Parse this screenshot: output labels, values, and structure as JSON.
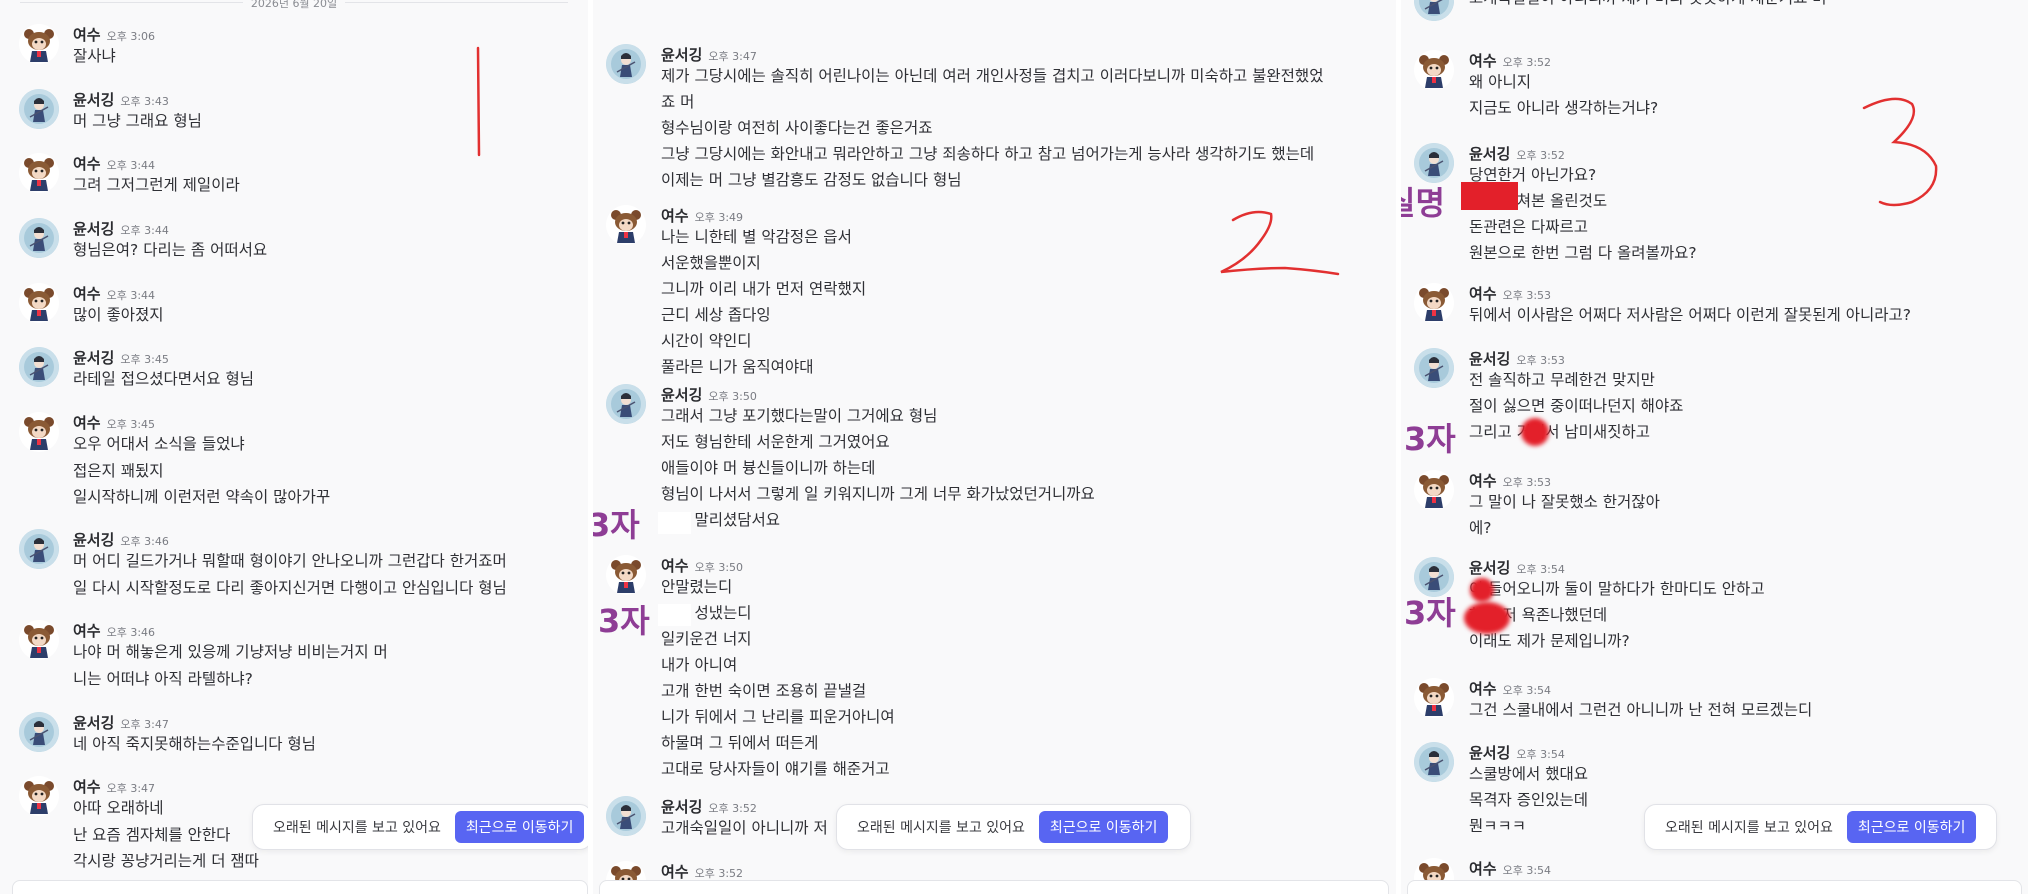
{
  "banner": {
    "text": "오래된 메시지를 보고 있어요",
    "button": "최근으로 이동하기"
  },
  "annotations": {
    "real_name": "실명",
    "third_party": "3자"
  },
  "panel1": {
    "date": "2026년 6월 20일",
    "messages": [
      {
        "user": "여수",
        "time": "오후 3:06",
        "avatar": "bear",
        "lines": [
          "잘사냐"
        ]
      },
      {
        "user": "윤서깅",
        "time": "오후 3:43",
        "avatar": "gal",
        "lines": [
          "머 그냥 그래요 형님"
        ]
      },
      {
        "user": "여수",
        "time": "오후 3:44",
        "avatar": "bear",
        "lines": [
          "그려 그저그런게 제일이라"
        ]
      },
      {
        "user": "윤서깅",
        "time": "오후 3:44",
        "avatar": "gal",
        "lines": [
          "형님은여? 다리는 좀 어떠서요"
        ]
      },
      {
        "user": "여수",
        "time": "오후 3:44",
        "avatar": "bear",
        "lines": [
          "많이 좋아졌지"
        ]
      },
      {
        "user": "윤서깅",
        "time": "오후 3:45",
        "avatar": "gal",
        "lines": [
          "라테일 접으셨다면서요 형님"
        ]
      },
      {
        "user": "여수",
        "time": "오후 3:45",
        "avatar": "bear",
        "lines": [
          "오우 어대서 소식을 들었냐",
          "접은지 꽤됬지",
          "일시작하니께 이런저런 약속이 많아가꾸"
        ]
      },
      {
        "user": "윤서깅",
        "time": "오후 3:46",
        "avatar": "gal",
        "lines": [
          "머 어디 길드가거나 뭐할때 형이야기 안나오니까 그런갑다 한거죠머",
          "일 다시 시작할정도로 다리 좋아지신거면 다행이고 안심입니다 형님"
        ]
      },
      {
        "user": "여수",
        "time": "오후 3:46",
        "avatar": "bear",
        "lines": [
          "나야 머 해놓은게 있응께 기냥저냥 비비는거지 머",
          "니는 어떠냐 아직 라텔하냐?"
        ]
      },
      {
        "user": "윤서깅",
        "time": "오후 3:47",
        "avatar": "gal",
        "lines": [
          "네 아직 죽지못해하는수준입니다 형님"
        ]
      },
      {
        "user": "여수",
        "time": "오후 3:47",
        "avatar": "bear",
        "lines": [
          "아따 오래하네",
          "난 요즘 겜자체를 안한다",
          "각시랑 꽁냥거리는게 더 잼따"
        ]
      }
    ]
  },
  "panel2": {
    "messages": [
      {
        "user": "",
        "time": "",
        "avatar": "",
        "lines": [
          "각시랑 꽁냥거리는게 더 잼따"
        ]
      },
      {
        "user": "윤서깅",
        "time": "오후 3:47",
        "avatar": "gal",
        "lines": [
          "제가 그당시에는 솔직히 어린나이는 아닌데 여러 개인사정들 겹치고 이러다보니까 미숙하고 불완전했었",
          "죠 머",
          "형수님이랑 여전히 사이좋다는건 좋은거죠",
          "그냥 그당시에는 화안내고 뭐라안하고 그냥 죄송하다 하고 참고 넘어가는게 능사라 생각하기도 했는데",
          "이제는 머 그냥 별감흥도 감정도 없습니다 형님"
        ]
      },
      {
        "user": "여수",
        "time": "오후 3:49",
        "avatar": "bear",
        "lines": [
          "나는 니한테 별 악감정은 읍서",
          "서운했을뿐이지",
          "그니까 이리 내가 먼저 연락했지",
          "근디 세상 좁다잉",
          "시간이 약인디",
          "풀라믄 니가 움직여야대"
        ]
      },
      {
        "user": "윤서깅",
        "time": "오후 3:50",
        "avatar": "gal",
        "lines": [
          "그래서 그냥 포기했다는말이 그거에요 형님",
          "저도 형님한테 서운한게 그거였어요",
          "애들이야 머 븅신들이니까 하는데",
          "형님이 나서서 그렇게 일 키워지니까 그게 너무 화가났었던거니까요",
          "형도 말리셨담서요"
        ]
      },
      {
        "user": "여수",
        "time": "오후 3:50",
        "avatar": "bear",
        "lines": [
          "안말렸는디",
          "햄도 성냈는디",
          "일키운건 너지",
          "내가 아니여",
          "고개 한번 숙이면 조용히 끝낼걸",
          "니가 뒤에서 그 난리를 피운거아니여",
          "하물며 그 뒤에서 떠든게",
          "고대로 당사자들이 얘기를 해준거고"
        ]
      },
      {
        "user": "윤서깅",
        "time": "오후 3:52",
        "avatar": "gal",
        "lines": [
          "고개숙일일이 아니니까 저"
        ]
      },
      {
        "user": "여수",
        "time": "오후 3:52",
        "avatar": "bear",
        "lines": []
      }
    ]
  },
  "panel3": {
    "messages": [
      {
        "user": "",
        "time": "",
        "avatar": "gal",
        "lines": [
          "고개숙일일이 아니니까 제가 머리 빳빳하게 세운거죠 머"
        ]
      },
      {
        "user": "여수",
        "time": "오후 3:52",
        "avatar": "bear",
        "lines": [
          "왜 아니지",
          "지금도 아니라 생각하는거냐?"
        ]
      },
      {
        "user": "윤서깅",
        "time": "오후 3:52",
        "avatar": "gal",
        "lines": [
          "당연한거 아닌가요?",
          "카톡 캡쳐본 올린것도",
          "돈관련은 다짜르고",
          "원본으로 한번 그럼 다 올려볼까요?"
        ]
      },
      {
        "user": "여수",
        "time": "오후 3:53",
        "avatar": "bear",
        "lines": [
          "뒤에서 이사람은 어쩌다 저사람은 어쩌다 이런게 잘못된게 아니라고?"
        ]
      },
      {
        "user": "윤서깅",
        "time": "오후 3:53",
        "avatar": "gal",
        "lines": [
          "전 솔직하고 무례한건 맞지만",
          "절이 싫으면 중이떠나던지 해야죠",
          "그리고 거기서 남미새짓하고"
        ]
      },
      {
        "user": "여수",
        "time": "오후 3:53",
        "avatar": "bear",
        "lines": [
          "그 말이 나 잘못했소 한거잖아",
          "에?"
        ]
      },
      {
        "user": "윤서깅",
        "time": "오후 3:54",
        "avatar": "gal",
        "lines": [
          "이 들어오니까 둘이 말하다가 한마디도 안하고",
          "한테 저 욕존나했던데",
          "이래도 제가 문제입니까?"
        ]
      },
      {
        "user": "여수",
        "time": "오후 3:54",
        "avatar": "bear",
        "lines": [
          "그건 스쿨내에서 그런건 아니니까 난 전혀 모르겠는디"
        ]
      },
      {
        "user": "윤서깅",
        "time": "오후 3:54",
        "avatar": "gal",
        "lines": [
          "스쿨방에서 했대요",
          "목격자 증인있는데",
          "뭔ㅋㅋㅋ"
        ]
      },
      {
        "user": "여수",
        "time": "오후 3:54",
        "avatar": "bear",
        "lines": []
      }
    ]
  }
}
